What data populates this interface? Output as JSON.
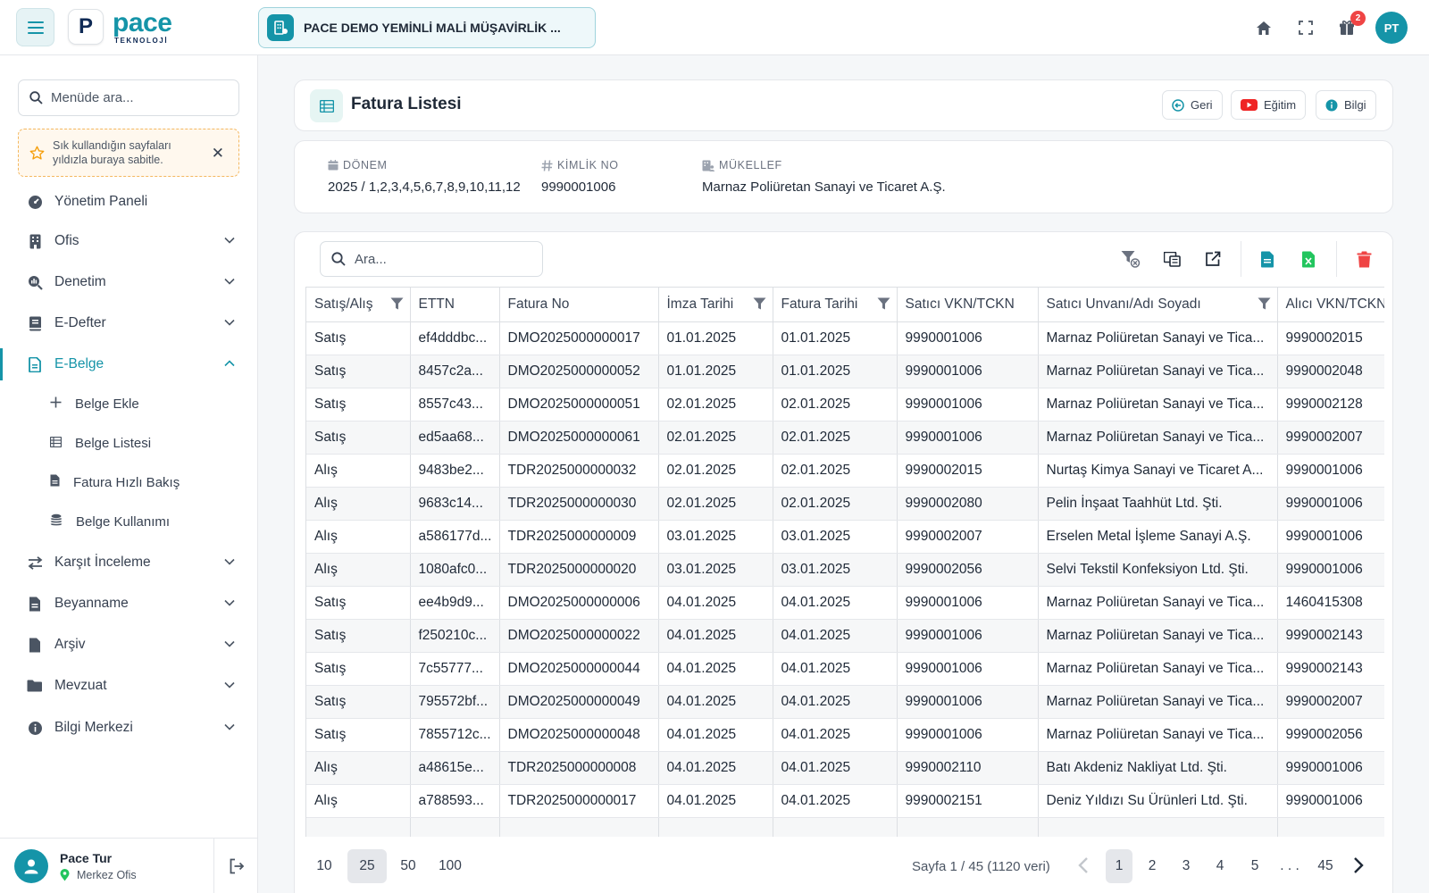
{
  "topbar": {
    "logo_letter": "P",
    "logo_word": "pace",
    "logo_sub": "TEKNOLOJİ",
    "company": "PACE DEMO YEMİNLİ MALİ MÜŞAVİRLİK ...",
    "notification_count": "2",
    "user_initials": "PT"
  },
  "sidebar": {
    "search_placeholder": "Menüde ara...",
    "fav_note": "Sık kullandığın sayfaları yıldızla buraya sabitle.",
    "items": [
      {
        "label": "Yönetim Paneli",
        "icon": "gauge-icon"
      },
      {
        "label": "Ofis",
        "icon": "building-icon"
      },
      {
        "label": "Denetim",
        "icon": "magnify-chart-icon"
      },
      {
        "label": "E-Defter",
        "icon": "book-icon"
      },
      {
        "label": "E-Belge",
        "icon": "document-icon"
      },
      {
        "label": "Karşıt İnceleme",
        "icon": "swap-arrows-icon"
      },
      {
        "label": "Beyanname",
        "icon": "file-text-icon"
      },
      {
        "label": "Arşiv",
        "icon": "file-icon"
      },
      {
        "label": "Mevzuat",
        "icon": "folder-icon"
      },
      {
        "label": "Bilgi Merkezi",
        "icon": "info-circle-icon"
      }
    ],
    "sub_items": [
      {
        "label": "Belge Ekle",
        "icon": "plus-icon"
      },
      {
        "label": "Belge Listesi",
        "icon": "table-list-icon"
      },
      {
        "label": "Fatura Hızlı Bakış",
        "icon": "file-small-icon"
      },
      {
        "label": "Belge Kullanımı",
        "icon": "coins-icon"
      }
    ],
    "user": {
      "name": "Pace Tur",
      "office": "Merkez Ofis"
    }
  },
  "header": {
    "title": "Fatura Listesi",
    "back": "Geri",
    "training": "Eğitim",
    "info": "Bilgi"
  },
  "info": {
    "period_label": "DÖNEM",
    "period_value": "2025 / 1,2,3,4,5,6,7,8,9,10,11,12",
    "id_label": "KİMLİK NO",
    "id_value": "9990001006",
    "taxpayer_label": "MÜKELLEF",
    "taxpayer_value": "Marnaz Poliüretan Sanayi ve Ticaret A.Ş."
  },
  "table": {
    "search_placeholder": "Ara...",
    "columns": [
      "Satış/Alış",
      "ETTN",
      "Fatura No",
      "İmza Tarihi",
      "Fatura Tarihi",
      "Satıcı VKN/TCKN",
      "Satıcı Unvanı/Adı Soyadı",
      "Alıcı VKN/TCKN"
    ],
    "rows": [
      [
        "Satış",
        "ef4dddbc...",
        "DMO2025000000017",
        "01.01.2025",
        "01.01.2025",
        "9990001006",
        "Marnaz Poliüretan Sanayi ve Tica...",
        "9990002015"
      ],
      [
        "Satış",
        "8457c2a...",
        "DMO2025000000052",
        "01.01.2025",
        "01.01.2025",
        "9990001006",
        "Marnaz Poliüretan Sanayi ve Tica...",
        "9990002048"
      ],
      [
        "Satış",
        "8557c43...",
        "DMO2025000000051",
        "02.01.2025",
        "02.01.2025",
        "9990001006",
        "Marnaz Poliüretan Sanayi ve Tica...",
        "9990002128"
      ],
      [
        "Satış",
        "ed5aa68...",
        "DMO2025000000061",
        "02.01.2025",
        "02.01.2025",
        "9990001006",
        "Marnaz Poliüretan Sanayi ve Tica...",
        "9990002007"
      ],
      [
        "Alış",
        "9483be2...",
        "TDR2025000000032",
        "02.01.2025",
        "02.01.2025",
        "9990002015",
        "Nurtaş Kimya Sanayi ve Ticaret A...",
        "9990001006"
      ],
      [
        "Alış",
        "9683c14...",
        "TDR2025000000030",
        "02.01.2025",
        "02.01.2025",
        "9990002080",
        "Pelin İnşaat Taahhüt Ltd. Şti.",
        "9990001006"
      ],
      [
        "Alış",
        "a586177d...",
        "TDR2025000000009",
        "03.01.2025",
        "03.01.2025",
        "9990002007",
        "Erselen Metal İşleme Sanayi A.Ş.",
        "9990001006"
      ],
      [
        "Alış",
        "1080afc0...",
        "TDR2025000000020",
        "03.01.2025",
        "03.01.2025",
        "9990002056",
        "Selvi Tekstil Konfeksiyon Ltd. Şti.",
        "9990001006"
      ],
      [
        "Satış",
        "ee4b9d9...",
        "DMO2025000000006",
        "04.01.2025",
        "04.01.2025",
        "9990001006",
        "Marnaz Poliüretan Sanayi ve Tica...",
        "1460415308"
      ],
      [
        "Satış",
        "f250210c...",
        "DMO2025000000022",
        "04.01.2025",
        "04.01.2025",
        "9990001006",
        "Marnaz Poliüretan Sanayi ve Tica...",
        "9990002143"
      ],
      [
        "Satış",
        "7c55777...",
        "DMO2025000000044",
        "04.01.2025",
        "04.01.2025",
        "9990001006",
        "Marnaz Poliüretan Sanayi ve Tica...",
        "9990002143"
      ],
      [
        "Satış",
        "795572bf...",
        "DMO2025000000049",
        "04.01.2025",
        "04.01.2025",
        "9990001006",
        "Marnaz Poliüretan Sanayi ve Tica...",
        "9990002007"
      ],
      [
        "Satış",
        "7855712c...",
        "DMO2025000000048",
        "04.01.2025",
        "04.01.2025",
        "9990001006",
        "Marnaz Poliüretan Sanayi ve Tica...",
        "9990002056"
      ],
      [
        "Alış",
        "a48615e...",
        "TDR2025000000008",
        "04.01.2025",
        "04.01.2025",
        "9990002110",
        "Batı Akdeniz Nakliyat Ltd. Şti.",
        "9990001006"
      ],
      [
        "Alış",
        "a788593...",
        "TDR2025000000017",
        "04.01.2025",
        "04.01.2025",
        "9990002151",
        "Deniz Yıldızı Su Ürünleri Ltd. Şti.",
        "9990001006"
      ]
    ]
  },
  "pagination": {
    "sizes": [
      "10",
      "25",
      "50",
      "100"
    ],
    "selected_size": "25",
    "info": "Sayfa 1 / 45 (1120 veri)",
    "pages": [
      "1",
      "2",
      "3",
      "4",
      "5"
    ],
    "ellipsis": ". . .",
    "last": "45",
    "current": "1"
  },
  "colors": {
    "accent": "#1594a8",
    "danger": "#ef4444",
    "excel": "#22c55e"
  }
}
